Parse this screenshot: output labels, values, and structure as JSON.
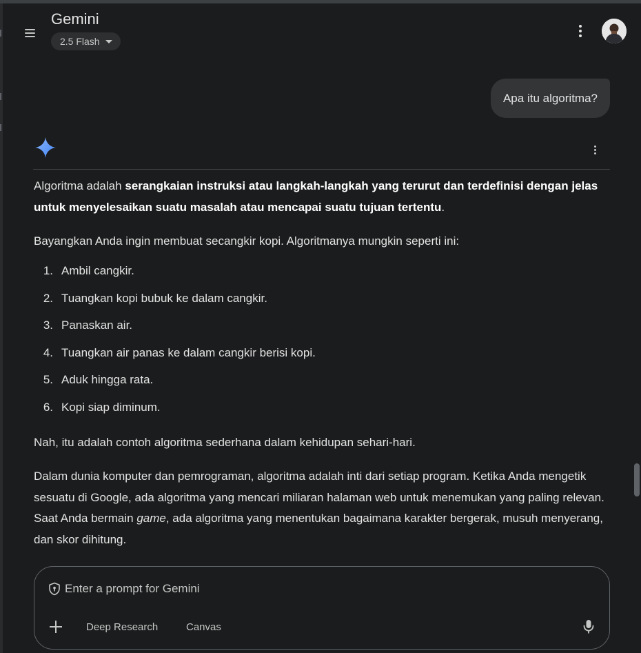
{
  "colors": {
    "background": "#1b1c1d",
    "text": "#e3e3e3",
    "muted_text": "#c4c7c5",
    "user_bubble": "#333537",
    "gemini_spark_blue": "#4285f4",
    "gemini_spark_light": "#8ab4f8"
  },
  "header": {
    "title": "Gemini",
    "model_label": "2.5 Flash",
    "icons": [
      "menu-icon",
      "chevron-down-icon",
      "more-vert-icon",
      "avatar"
    ]
  },
  "user_message": "Apa itu algoritma?",
  "response": {
    "intro_plain": "Algoritma adalah ",
    "intro_bold": "serangkaian instruksi atau langkah-langkah yang terurut dan terdefinisi dengan jelas untuk menyelesaikan suatu masalah atau mencapai suatu tujuan tertentu",
    "intro_end": ".",
    "analogy": "Bayangkan Anda ingin membuat secangkir kopi. Algoritmanya mungkin seperti ini:",
    "steps": [
      {
        "num": "1.",
        "text": "Ambil cangkir."
      },
      {
        "num": "2.",
        "text": "Tuangkan kopi bubuk ke dalam cangkir."
      },
      {
        "num": "3.",
        "text": "Panaskan air."
      },
      {
        "num": "4.",
        "text": "Tuangkan air panas ke dalam cangkir berisi kopi."
      },
      {
        "num": "5.",
        "text": "Aduk hingga rata."
      },
      {
        "num": "6.",
        "text": "Kopi siap diminum."
      }
    ],
    "summary": "Nah, itu adalah contoh algoritma sederhana dalam kehidupan sehari-hari.",
    "computing_part1": "Dalam dunia komputer dan pemrograman, algoritma adalah inti dari setiap program. Ketika Anda mengetik sesuatu di Google, ada algoritma yang mencari miliaran halaman web untuk menemukan yang paling relevan. Saat Anda bermain ",
    "computing_italic": "game",
    "computing_part2": ", ada algoritma yang menentukan bagaimana karakter bergerak, musuh menyerang, dan skor dihitung."
  },
  "composer": {
    "placeholder": "Enter a prompt for Gemini",
    "deep_research_label": "Deep Research",
    "canvas_label": "Canvas"
  }
}
